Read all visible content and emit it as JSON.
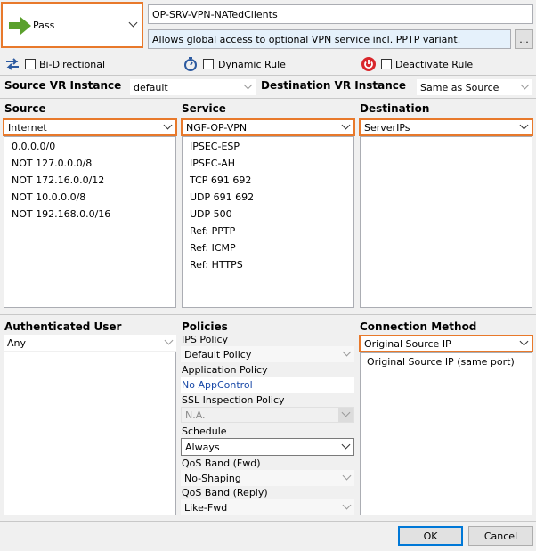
{
  "action": {
    "label": "Pass",
    "color": "#5aa02c",
    "icon": "arrow-right-icon"
  },
  "rule_name": "OP-SRV-VPN-NATedClients",
  "rule_description": "Allows global access to optional  VPN service incl. PPTP variant.",
  "more_button": "...",
  "options": {
    "bidirectional": "Bi-Directional",
    "dynamic_rule": "Dynamic Rule",
    "deactivate_rule": "Deactivate Rule"
  },
  "vr": {
    "source_label": "Source VR Instance",
    "source_value": "default",
    "dest_label": "Destination VR Instance",
    "dest_value": "Same as Source"
  },
  "source": {
    "header": "Source",
    "selected": "Internet",
    "items": [
      "0.0.0.0/0",
      "NOT 127.0.0.0/8",
      "NOT 172.16.0.0/12",
      "NOT 10.0.0.0/8",
      "NOT 192.168.0.0/16"
    ]
  },
  "service": {
    "header": "Service",
    "selected": "NGF-OP-VPN",
    "items": [
      "IPSEC-ESP",
      "IPSEC-AH",
      "TCP  691 692",
      "UDP  691 692",
      "UDP  500",
      "Ref: PPTP",
      "Ref: ICMP",
      "Ref: HTTPS"
    ]
  },
  "destination": {
    "header": "Destination",
    "selected": "ServerIPs",
    "items": []
  },
  "auth_user": {
    "header": "Authenticated User",
    "selected": "Any"
  },
  "policies": {
    "header": "Policies",
    "ips_label": "IPS Policy",
    "ips_value": "Default Policy",
    "app_label": "Application Policy",
    "app_value": "No AppControl",
    "ssl_label": "SSL Inspection Policy",
    "ssl_value": "N.A.",
    "schedule_label": "Schedule",
    "schedule_value": "Always",
    "qos_fwd_label": "QoS Band (Fwd)",
    "qos_fwd_value": "No-Shaping",
    "qos_reply_label": "QoS Band (Reply)",
    "qos_reply_value": "Like-Fwd"
  },
  "connection": {
    "header": "Connection Method",
    "selected": "Original Source IP",
    "items": [
      "Original Source IP (same port)"
    ]
  },
  "buttons": {
    "ok": "OK",
    "cancel": "Cancel"
  }
}
